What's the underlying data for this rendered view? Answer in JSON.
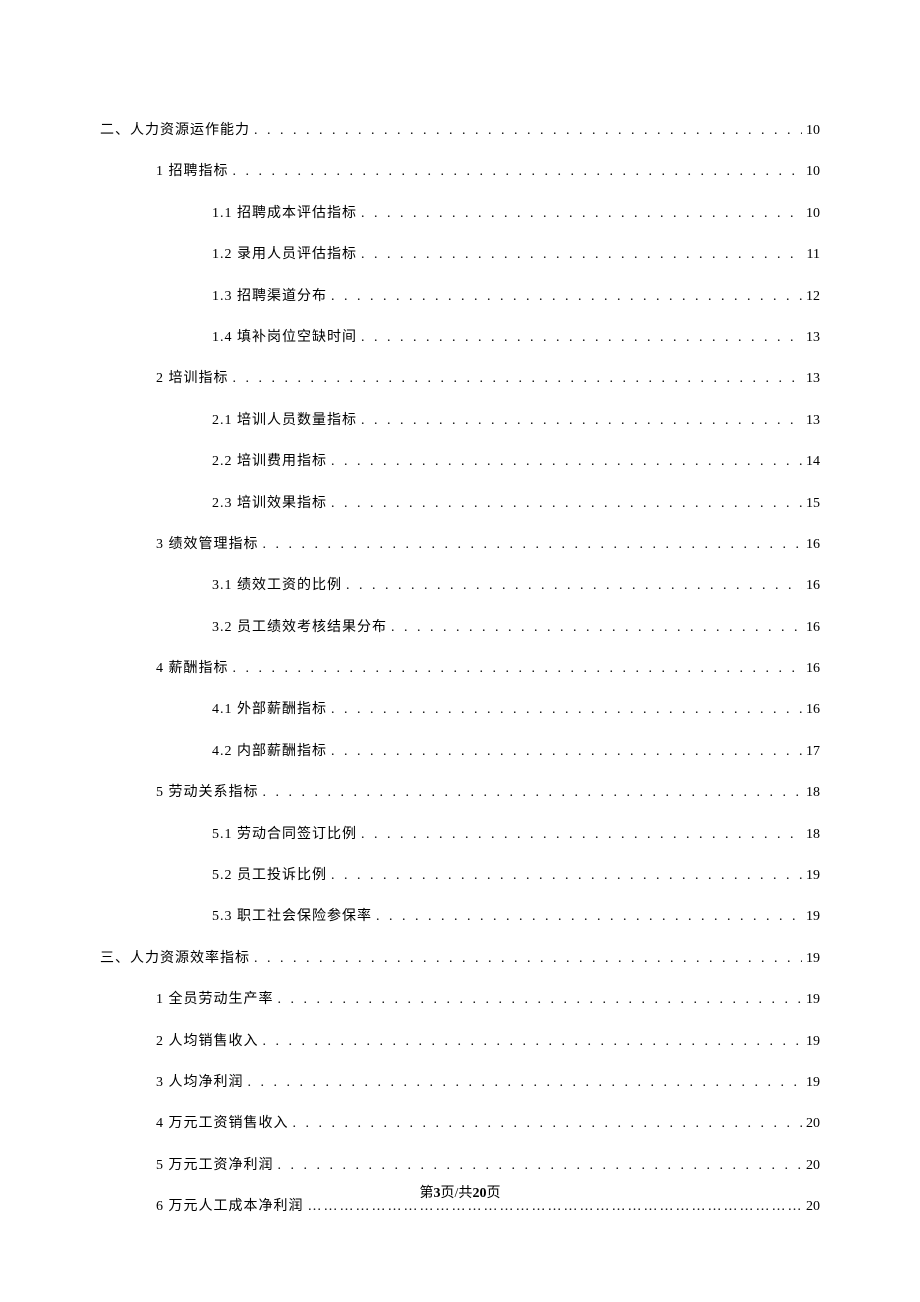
{
  "toc": [
    {
      "level": 1,
      "title": "二、人力资源运作能力",
      "page": "10",
      "leader": "dot"
    },
    {
      "level": 2,
      "title": "1 招聘指标",
      "page": "10",
      "leader": "dot"
    },
    {
      "level": 3,
      "title": "1.1 招聘成本评估指标",
      "page": "10",
      "leader": "dot"
    },
    {
      "level": 3,
      "title": "1.2 录用人员评估指标",
      "page": "11",
      "leader": "dot"
    },
    {
      "level": 3,
      "title": "1.3 招聘渠道分布",
      "page": "12",
      "leader": "dot"
    },
    {
      "level": 3,
      "title": "1.4 填补岗位空缺时间",
      "page": "13",
      "leader": "dot"
    },
    {
      "level": 2,
      "title": "2 培训指标",
      "page": "13",
      "leader": "dot"
    },
    {
      "level": 3,
      "title": "2.1 培训人员数量指标",
      "page": "13",
      "leader": "dot"
    },
    {
      "level": 3,
      "title": "2.2 培训费用指标",
      "page": "14",
      "leader": "dot"
    },
    {
      "level": 3,
      "title": "2.3 培训效果指标",
      "page": "15",
      "leader": "dot"
    },
    {
      "level": 2,
      "title": "3 绩效管理指标",
      "page": "16",
      "leader": "dot"
    },
    {
      "level": 3,
      "title": "3.1 绩效工资的比例",
      "page": "16",
      "leader": "dot"
    },
    {
      "level": 3,
      "title": "3.2 员工绩效考核结果分布",
      "page": "16",
      "leader": "dot"
    },
    {
      "level": 2,
      "title": "4 薪酬指标",
      "page": "16",
      "leader": "dot"
    },
    {
      "level": 3,
      "title": "4.1 外部薪酬指标",
      "page": "16",
      "leader": "dot"
    },
    {
      "level": 3,
      "title": "4.2 内部薪酬指标",
      "page": "17",
      "leader": "dot"
    },
    {
      "level": 2,
      "title": "5 劳动关系指标",
      "page": "18",
      "leader": "dot"
    },
    {
      "level": 3,
      "title": "5.1 劳动合同签订比例",
      "page": "18",
      "leader": "dot"
    },
    {
      "level": 3,
      "title": "5.2 员工投诉比例",
      "page": "19",
      "leader": "dot"
    },
    {
      "level": 3,
      "title": "5.3 职工社会保险参保率",
      "page": "19",
      "leader": "dot"
    },
    {
      "level": 1,
      "title": "三、人力资源效率指标",
      "page": "19",
      "leader": "dot"
    },
    {
      "level": 2,
      "title": "1 全员劳动生产率",
      "page": "19",
      "leader": "dot"
    },
    {
      "level": 2,
      "title": "2 人均销售收入",
      "page": "19",
      "leader": "dot"
    },
    {
      "level": 2,
      "title": "3 人均净利润",
      "page": "19",
      "leader": "dot"
    },
    {
      "level": 2,
      "title": "4 万元工资销售收入",
      "page": "20",
      "leader": "dot"
    },
    {
      "level": 2,
      "title": "5 万元工资净利润",
      "page": "20",
      "leader": "dot"
    },
    {
      "level": 2,
      "title": "6 万元人工成本净利润",
      "page": "20",
      "leader": "cn"
    }
  ],
  "footer": {
    "prefix": "第",
    "current": "3",
    "middle": "页/共",
    "total": "20",
    "suffix": "页"
  }
}
